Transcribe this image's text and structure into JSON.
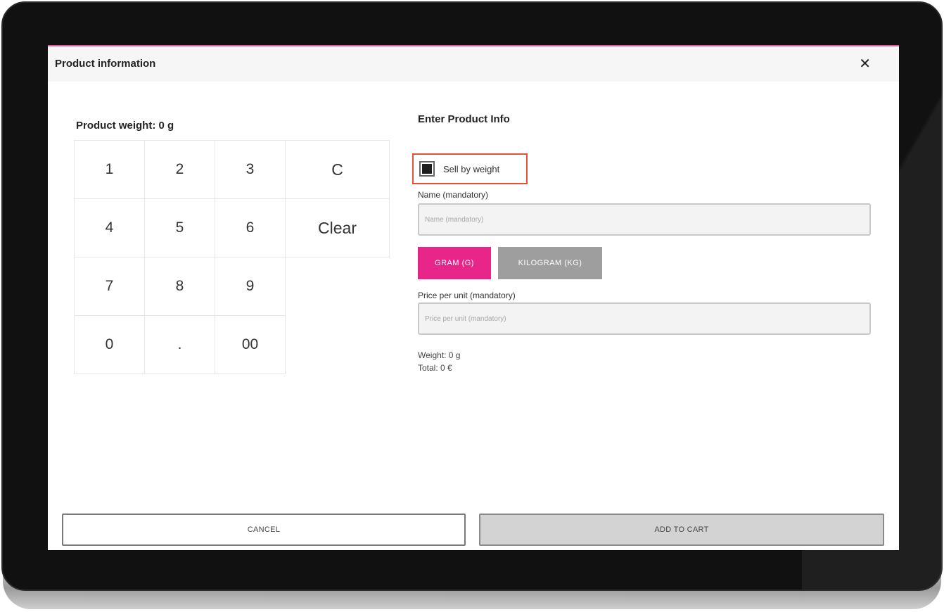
{
  "dialog": {
    "title": "Product information",
    "close_icon": "close-icon",
    "close_symbol": "✕"
  },
  "keypad": {
    "title": "Product weight: 0 g",
    "keys": [
      "1",
      "2",
      "3",
      "C",
      "4",
      "5",
      "6",
      "Clear",
      "7",
      "8",
      "9",
      "",
      "0",
      ".",
      "00",
      ""
    ]
  },
  "form": {
    "title": "Enter Product Info",
    "sell_by_weight": {
      "label": "Sell by weight",
      "checked": true
    },
    "name": {
      "label": "Name (mandatory)",
      "placeholder": "Name (mandatory)",
      "value": ""
    },
    "units": {
      "gram": "GRAM (G)",
      "kilogram": "KILOGRAM (KG)",
      "selected": "gram"
    },
    "price": {
      "label": "Price per unit (mandatory)",
      "placeholder": "Price per unit (mandatory)",
      "value": ""
    },
    "weight_summary": "Weight: 0 g",
    "total_summary": "Total: 0 €"
  },
  "footer": {
    "cancel": "CANCEL",
    "add_to_cart": "ADD TO CART"
  },
  "colors": {
    "accent": "#e8268a",
    "unit_inactive": "#9e9e9e",
    "highlight_border": "#e2533c"
  }
}
